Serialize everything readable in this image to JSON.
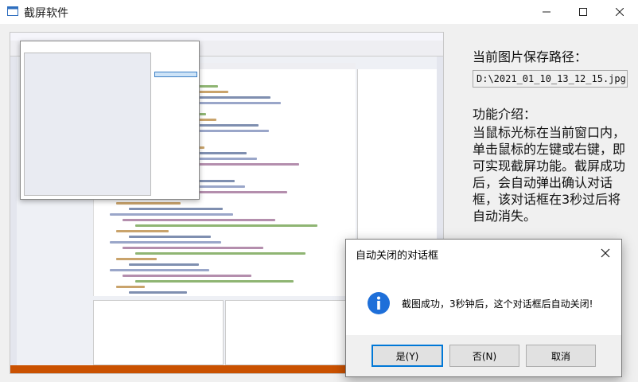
{
  "window": {
    "title": "截屏软件",
    "controls": {
      "minimize_icon": "minimize-icon",
      "maximize_icon": "maximize-icon",
      "close_icon": "close-icon"
    }
  },
  "info": {
    "save_path_label": "当前图片保存路径：",
    "save_path_value": "D:\\2021_01_10_13_12_15.jpg",
    "function_label": "功能介绍：",
    "function_desc": "当鼠标光标在当前窗口内，单击鼠标的左键或右键，即可实现截屏功能。截屏成功后，会自动弹出确认对话框，该对话框在3秒过后将自动消失。"
  },
  "dialog": {
    "title": "自动关闭的对话框",
    "message": "截图成功，3秒钟后，这个对话框后自动关闭!",
    "icon": "info-icon",
    "buttons": {
      "yes": "是(Y)",
      "no": "否(N)",
      "cancel": "取消"
    }
  },
  "colors": {
    "accent": "#0078d7",
    "vs_status": "#ca5100",
    "info_icon": "#1e6fd9"
  }
}
